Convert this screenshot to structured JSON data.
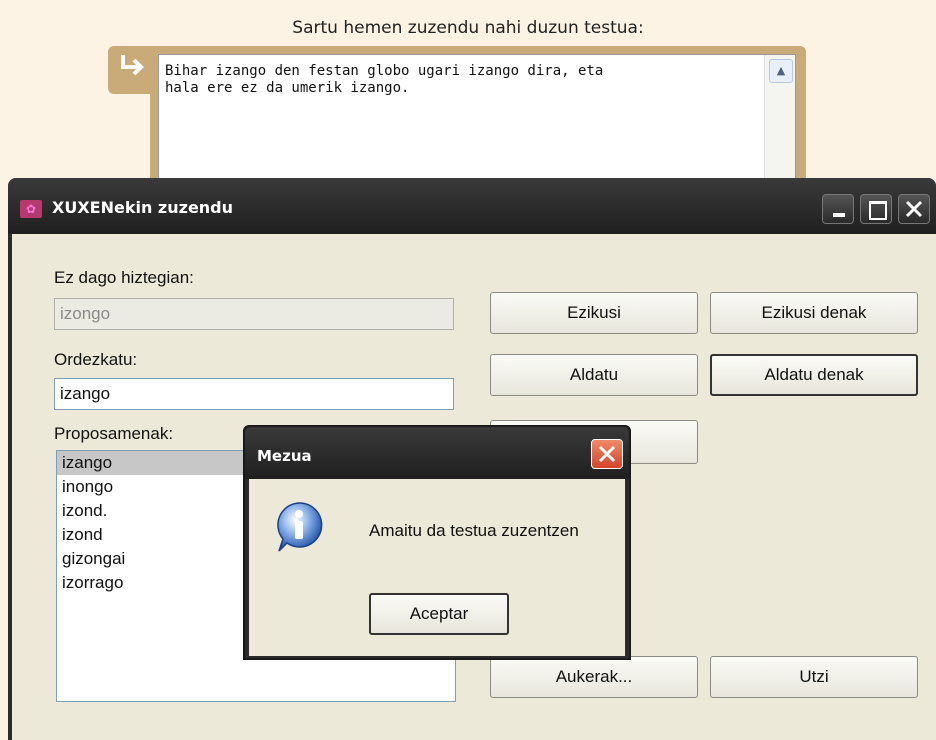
{
  "page": {
    "instruction": "Sartu hemen zuzendu nahi duzun testua:",
    "input_text": "Bihar izango den festan globo ugari izango dira, eta\nhala ere ez da umerik izango."
  },
  "dialog": {
    "title": "XUXENekin zuzendu",
    "not_in_dictionary_label": "Ez dago hiztegian:",
    "not_in_dictionary_value": "izongo",
    "replace_label": "Ordezkatu:",
    "replace_value": "izango",
    "suggestions_label": "Proposamenak:",
    "suggestions": [
      "izango",
      "inongo",
      "izond.",
      "izond",
      "gizongai",
      "izorrago"
    ],
    "buttons": {
      "ignore": "Ezikusi",
      "ignore_all": "Ezikusi denak",
      "change": "Aldatu",
      "change_all": "Aldatu denak",
      "options": "Aukerak...",
      "cancel": "Utzi"
    }
  },
  "message_box": {
    "title": "Mezua",
    "text": "Amaitu da testua zuzentzen",
    "ok_label": "Aceptar"
  },
  "colors": {
    "page_background": "#fcf3e4",
    "frame_accent": "#c9ab79",
    "titlebar": "#2c2c2c",
    "dialog_face": "#ece9d8",
    "close_button_red": "#d3442a"
  }
}
